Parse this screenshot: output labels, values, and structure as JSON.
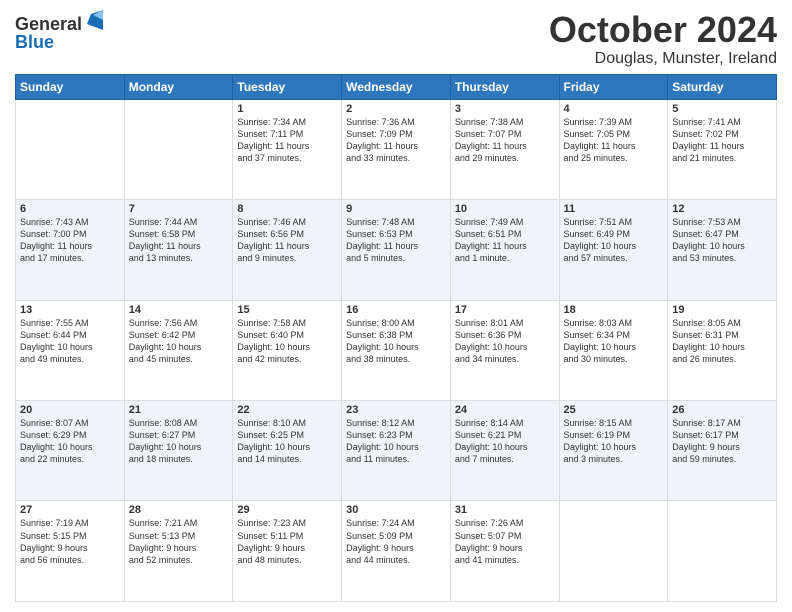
{
  "header": {
    "logo_general": "General",
    "logo_blue": "Blue",
    "month": "October 2024",
    "location": "Douglas, Munster, Ireland"
  },
  "days_of_week": [
    "Sunday",
    "Monday",
    "Tuesday",
    "Wednesday",
    "Thursday",
    "Friday",
    "Saturday"
  ],
  "weeks": [
    [
      {
        "day": "",
        "info": ""
      },
      {
        "day": "",
        "info": ""
      },
      {
        "day": "1",
        "info": "Sunrise: 7:34 AM\nSunset: 7:11 PM\nDaylight: 11 hours\nand 37 minutes."
      },
      {
        "day": "2",
        "info": "Sunrise: 7:36 AM\nSunset: 7:09 PM\nDaylight: 11 hours\nand 33 minutes."
      },
      {
        "day": "3",
        "info": "Sunrise: 7:38 AM\nSunset: 7:07 PM\nDaylight: 11 hours\nand 29 minutes."
      },
      {
        "day": "4",
        "info": "Sunrise: 7:39 AM\nSunset: 7:05 PM\nDaylight: 11 hours\nand 25 minutes."
      },
      {
        "day": "5",
        "info": "Sunrise: 7:41 AM\nSunset: 7:02 PM\nDaylight: 11 hours\nand 21 minutes."
      }
    ],
    [
      {
        "day": "6",
        "info": "Sunrise: 7:43 AM\nSunset: 7:00 PM\nDaylight: 11 hours\nand 17 minutes."
      },
      {
        "day": "7",
        "info": "Sunrise: 7:44 AM\nSunset: 6:58 PM\nDaylight: 11 hours\nand 13 minutes."
      },
      {
        "day": "8",
        "info": "Sunrise: 7:46 AM\nSunset: 6:56 PM\nDaylight: 11 hours\nand 9 minutes."
      },
      {
        "day": "9",
        "info": "Sunrise: 7:48 AM\nSunset: 6:53 PM\nDaylight: 11 hours\nand 5 minutes."
      },
      {
        "day": "10",
        "info": "Sunrise: 7:49 AM\nSunset: 6:51 PM\nDaylight: 11 hours\nand 1 minute."
      },
      {
        "day": "11",
        "info": "Sunrise: 7:51 AM\nSunset: 6:49 PM\nDaylight: 10 hours\nand 57 minutes."
      },
      {
        "day": "12",
        "info": "Sunrise: 7:53 AM\nSunset: 6:47 PM\nDaylight: 10 hours\nand 53 minutes."
      }
    ],
    [
      {
        "day": "13",
        "info": "Sunrise: 7:55 AM\nSunset: 6:44 PM\nDaylight: 10 hours\nand 49 minutes."
      },
      {
        "day": "14",
        "info": "Sunrise: 7:56 AM\nSunset: 6:42 PM\nDaylight: 10 hours\nand 45 minutes."
      },
      {
        "day": "15",
        "info": "Sunrise: 7:58 AM\nSunset: 6:40 PM\nDaylight: 10 hours\nand 42 minutes."
      },
      {
        "day": "16",
        "info": "Sunrise: 8:00 AM\nSunset: 6:38 PM\nDaylight: 10 hours\nand 38 minutes."
      },
      {
        "day": "17",
        "info": "Sunrise: 8:01 AM\nSunset: 6:36 PM\nDaylight: 10 hours\nand 34 minutes."
      },
      {
        "day": "18",
        "info": "Sunrise: 8:03 AM\nSunset: 6:34 PM\nDaylight: 10 hours\nand 30 minutes."
      },
      {
        "day": "19",
        "info": "Sunrise: 8:05 AM\nSunset: 6:31 PM\nDaylight: 10 hours\nand 26 minutes."
      }
    ],
    [
      {
        "day": "20",
        "info": "Sunrise: 8:07 AM\nSunset: 6:29 PM\nDaylight: 10 hours\nand 22 minutes."
      },
      {
        "day": "21",
        "info": "Sunrise: 8:08 AM\nSunset: 6:27 PM\nDaylight: 10 hours\nand 18 minutes."
      },
      {
        "day": "22",
        "info": "Sunrise: 8:10 AM\nSunset: 6:25 PM\nDaylight: 10 hours\nand 14 minutes."
      },
      {
        "day": "23",
        "info": "Sunrise: 8:12 AM\nSunset: 6:23 PM\nDaylight: 10 hours\nand 11 minutes."
      },
      {
        "day": "24",
        "info": "Sunrise: 8:14 AM\nSunset: 6:21 PM\nDaylight: 10 hours\nand 7 minutes."
      },
      {
        "day": "25",
        "info": "Sunrise: 8:15 AM\nSunset: 6:19 PM\nDaylight: 10 hours\nand 3 minutes."
      },
      {
        "day": "26",
        "info": "Sunrise: 8:17 AM\nSunset: 6:17 PM\nDaylight: 9 hours\nand 59 minutes."
      }
    ],
    [
      {
        "day": "27",
        "info": "Sunrise: 7:19 AM\nSunset: 5:15 PM\nDaylight: 9 hours\nand 56 minutes."
      },
      {
        "day": "28",
        "info": "Sunrise: 7:21 AM\nSunset: 5:13 PM\nDaylight: 9 hours\nand 52 minutes."
      },
      {
        "day": "29",
        "info": "Sunrise: 7:23 AM\nSunset: 5:11 PM\nDaylight: 9 hours\nand 48 minutes."
      },
      {
        "day": "30",
        "info": "Sunrise: 7:24 AM\nSunset: 5:09 PM\nDaylight: 9 hours\nand 44 minutes."
      },
      {
        "day": "31",
        "info": "Sunrise: 7:26 AM\nSunset: 5:07 PM\nDaylight: 9 hours\nand 41 minutes."
      },
      {
        "day": "",
        "info": ""
      },
      {
        "day": "",
        "info": ""
      }
    ]
  ]
}
